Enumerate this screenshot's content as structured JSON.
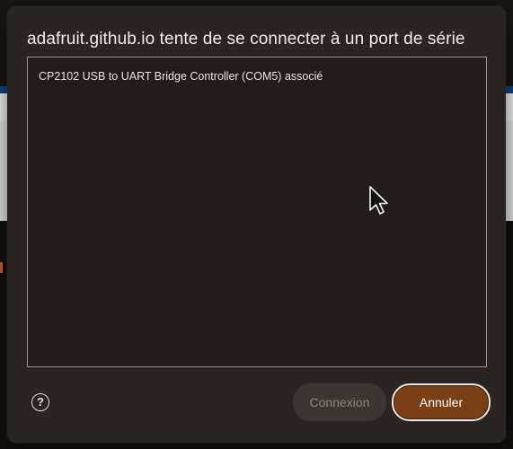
{
  "dialog": {
    "title": "adafruit.github.io tente de se connecter à un port de série",
    "devices": [
      {
        "label": "CP2102 USB to UART Bridge Controller (COM5) associé"
      }
    ],
    "help_symbol": "?",
    "buttons": {
      "connect_label": "Connexion",
      "cancel_label": "Annuler"
    }
  },
  "colors": {
    "dialog_bg": "#2a2422",
    "accent": "#7a3f14",
    "list_border": "#9c938f"
  },
  "icons": {
    "help": "help-circle-icon",
    "cursor": "mouse-pointer-icon"
  }
}
